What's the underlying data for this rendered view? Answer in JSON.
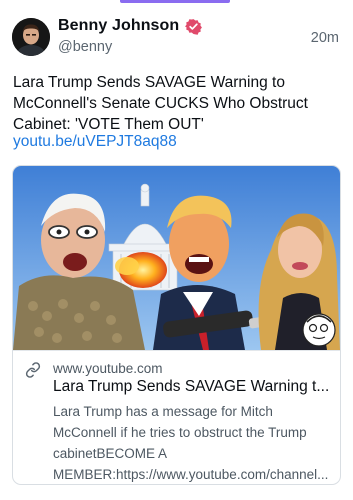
{
  "author": {
    "display_name": "Benny Johnson",
    "handle": "@benny",
    "verified": true
  },
  "timestamp": "20m",
  "post": {
    "text": "Lara Trump Sends SAVAGE Warning to\nMcConnell's Senate CUCKS Who Obstruct\nCabinet: 'VOTE Them OUT'",
    "link": "youtu.be/uVEPJT8aq88"
  },
  "link_card": {
    "domain": "www.youtube.com",
    "title": "Lara Trump Sends SAVAGE Warning t...",
    "description_lines": [
      "Lara Trump has a message for Mitch",
      "McConnell if he tries to obstruct the Trump",
      "cabinetBECOME A",
      "MEMBER:https://www.youtube.com/channel..."
    ],
    "icon": "link-icon"
  },
  "colors": {
    "accent": "#8a6cf0",
    "link": "#1f7ae0",
    "verified_badge": "#e04a6b",
    "secondary_text": "#5b6670"
  }
}
